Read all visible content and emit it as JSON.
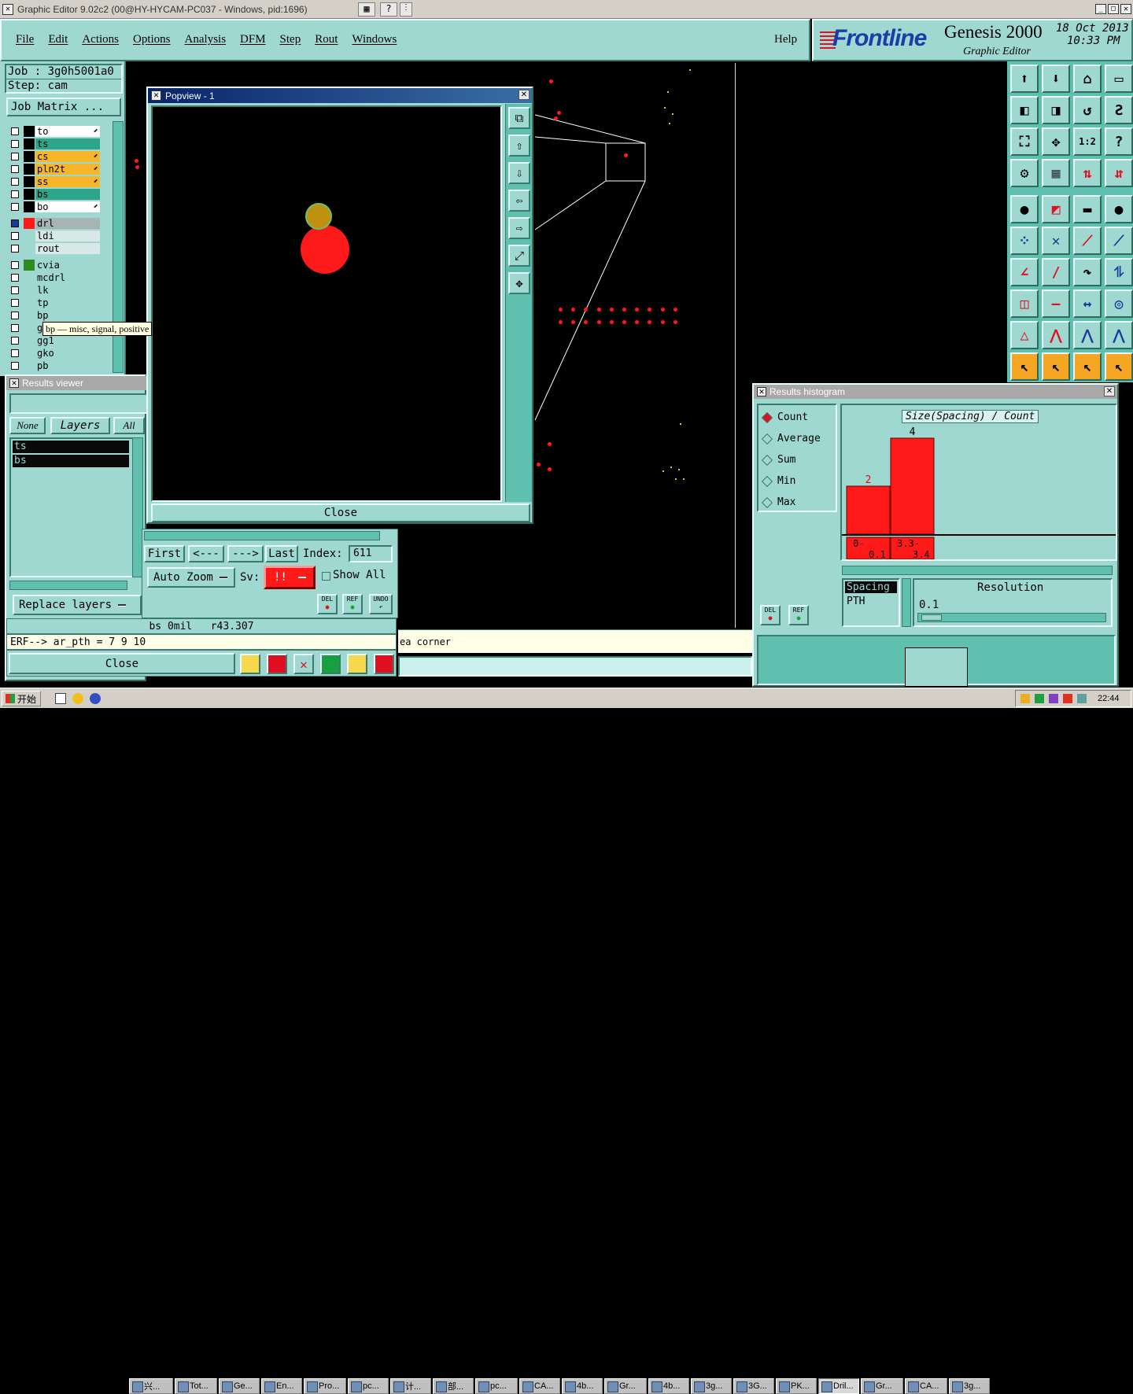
{
  "window": {
    "title": "Graphic Editor 9.02c2 (00@HY-HYCAM-PC037 - Windows, pid:1696)"
  },
  "menu": [
    "File",
    "Edit",
    "Actions",
    "Options",
    "Analysis",
    "DFM",
    "Step",
    "Rout",
    "Windows"
  ],
  "help_label": "Help",
  "brand": {
    "logo": "Frontline",
    "product": "Genesis 2000",
    "subtitle": "Graphic Editor",
    "date": "18 Oct 2013",
    "time": "10:33 PM"
  },
  "job": {
    "job_line": "Job : 3g0h5001a0",
    "step_line": "Step: cam",
    "matrix_label": "Job Matrix ..."
  },
  "layers_group1": [
    {
      "name": "to",
      "color": "#ffffff",
      "mark": true
    },
    {
      "name": "ts",
      "color": "#2ea58a",
      "mark": false
    },
    {
      "name": "cs",
      "color": "#f5b62a",
      "mark": true
    },
    {
      "name": "pln2t",
      "color": "#f5b62a",
      "mark": true
    },
    {
      "name": "ss",
      "color": "#f5b62a",
      "mark": true
    },
    {
      "name": "bs",
      "color": "#2ea58a",
      "mark": false
    },
    {
      "name": "bo",
      "color": "#ffffff",
      "mark": true
    }
  ],
  "layers_group2": [
    "drl",
    "ldi",
    "rout"
  ],
  "layers_group3": [
    "cvia",
    "mcdrl",
    "lk",
    "tp",
    "bp",
    "gtl",
    "gg1",
    "gko",
    "pb"
  ],
  "tooltip": "bp — misc, signal, positive",
  "results_viewer": {
    "title": "Results viewer",
    "tabs": [
      "None",
      "Layers",
      "All"
    ],
    "items": [
      "ts",
      "bs"
    ],
    "replace_label": "Replace layers",
    "info_line": "bs 0mil   r43.307",
    "erf_line": "ERF--> ar_pth = 7 9 10",
    "close_label": "Close"
  },
  "popview": {
    "title": "Popview - 1",
    "close_label": "Close"
  },
  "nav": {
    "first": "First",
    "prev": "<---",
    "next": "--->",
    "last": "Last",
    "index_label": "Index:",
    "index_value": "611",
    "autozoom": "Auto Zoom",
    "sv_label": "Sv:",
    "sv_value": "!!",
    "show_all": "Show All",
    "del": "DEL",
    "ref": "REF",
    "undo": "UNDO"
  },
  "status_text": "ea corner",
  "histogram": {
    "title": "Results histogram",
    "options": [
      "Count",
      "Average",
      "Sum",
      "Min",
      "Max"
    ],
    "selected": "Count",
    "chart_title": "Size(Spacing) / Count",
    "bars": [
      {
        "range_label": "0-\n0.1",
        "count": 2
      },
      {
        "range_label": "3.3-\n3.4",
        "count": 4
      }
    ],
    "list_header": "Spacing",
    "list_item": "PTH",
    "resolution_label": "Resolution",
    "resolution_value": "0.1",
    "del": "DEL",
    "ref": "REF"
  },
  "taskbar": {
    "start": "开始",
    "clock": "22:44",
    "items": [
      "兴...",
      "Tot...",
      "Ge...",
      "En...",
      "Pro...",
      "pc...",
      "计...",
      "部...",
      "pc...",
      "CA...",
      "4b...",
      "Gr...",
      "4b...",
      "3g...",
      "3G...",
      "PK...",
      "Dril...",
      "Gr...",
      "CA...",
      "3g..."
    ]
  },
  "colors": {
    "teal": "#9ed8d0",
    "dark_teal": "#5fc0b0",
    "pad_red": "#ff1a1a",
    "accent_orange": "#f5a623"
  }
}
